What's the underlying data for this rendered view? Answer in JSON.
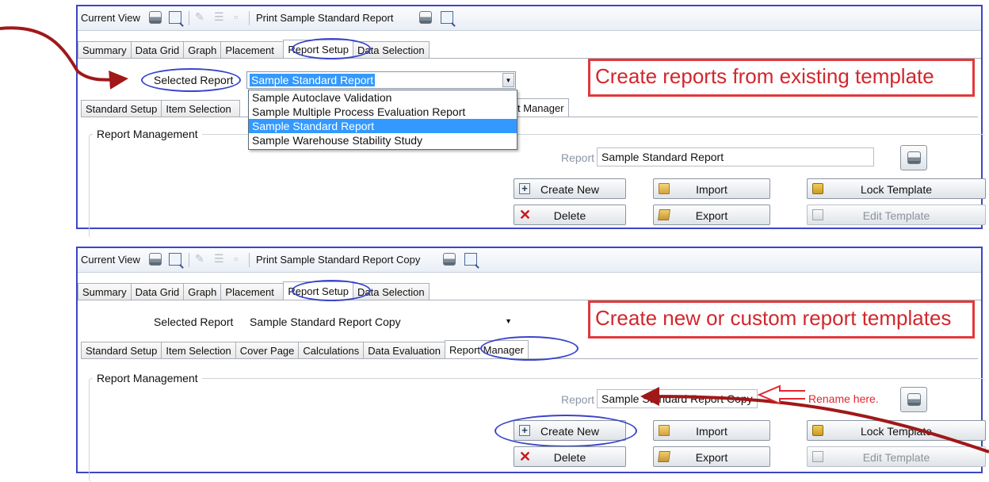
{
  "panel1": {
    "toolbar": {
      "current_view": "Current View",
      "print_label": "Print Sample Standard Report"
    },
    "main_tabs": [
      "Summary",
      "Data Grid",
      "Graph",
      "Placement",
      "Report Setup",
      "Data Selection"
    ],
    "selected_report_label": "Selected Report",
    "selected_report_value": "Sample Standard Report",
    "dropdown_options": [
      "Sample Autoclave Validation",
      "Sample Multiple Process Evaluation Report",
      "Sample Standard Report",
      "Sample Warehouse Stability Study"
    ],
    "sub_tabs": [
      "Standard Setup",
      "Item Selection"
    ],
    "partial_tab": "t Manager",
    "group_title": "Report Management",
    "report_field_label": "Report",
    "report_field_value": "Sample Standard Report",
    "buttons": {
      "create_new": "Create New",
      "import": "Import",
      "lock_template": "Lock Template",
      "delete": "Delete",
      "export": "Export",
      "edit_template": "Edit Template"
    },
    "callout": "Create reports from existing template"
  },
  "panel2": {
    "toolbar": {
      "current_view": "Current View",
      "print_label": "Print Sample Standard Report Copy"
    },
    "main_tabs": [
      "Summary",
      "Data Grid",
      "Graph",
      "Placement",
      "Report Setup",
      "Data Selection"
    ],
    "selected_report_label": "Selected Report",
    "selected_report_value": "Sample Standard Report Copy",
    "sub_tabs": [
      "Standard Setup",
      "Item Selection",
      "Cover Page",
      "Calculations",
      "Data Evaluation",
      "Report Manager"
    ],
    "group_title": "Report Management",
    "report_field_label": "Report",
    "report_field_value": "Sample Standard Report Copy",
    "rename_hint": "Rename here.",
    "buttons": {
      "create_new": "Create New",
      "import": "Import",
      "lock_template": "Lock Template",
      "delete": "Delete",
      "export": "Export",
      "edit_template": "Edit Template"
    },
    "callout": "Create new or custom report templates"
  },
  "colors": {
    "panel_border": "#3d46c6",
    "callout_red": "#e2393c",
    "arrow_red": "#a01818",
    "highlight_blue": "#3399ff",
    "ellipse_blue": "#3a44cc"
  },
  "icons": [
    "printer-icon",
    "print-preview-icon",
    "brush-icon",
    "list-icon",
    "box-icon",
    "plus-icon",
    "delete-x-icon",
    "folder-icon",
    "export-icon",
    "lock-icon",
    "document-icon",
    "arrow-annotation",
    "rename-arrow"
  ]
}
